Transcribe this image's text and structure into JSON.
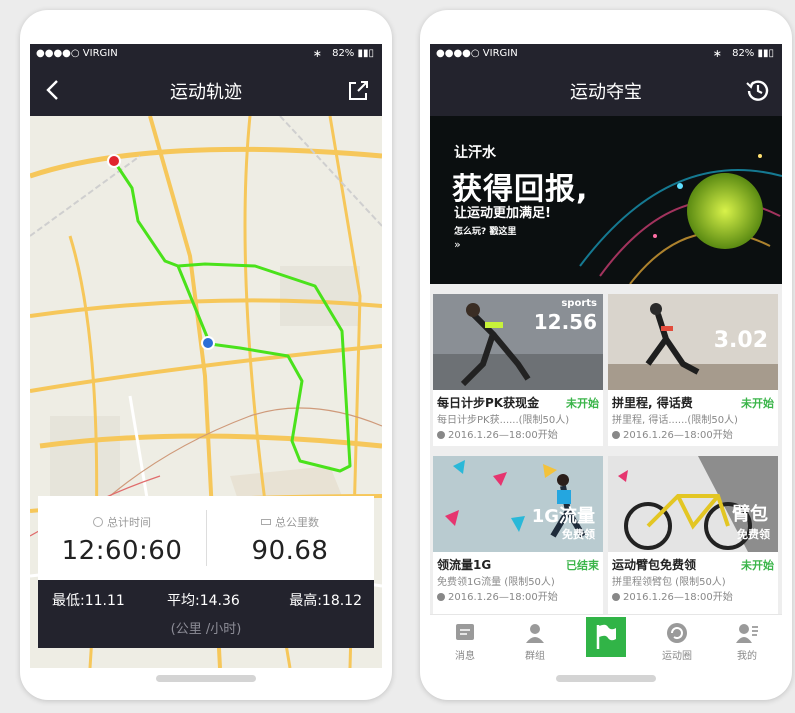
{
  "left_phone": {
    "status": {
      "carrier": "●●●●○ VIRGIN",
      "bluetooth": "∗",
      "battery": "82%"
    },
    "nav": {
      "title": "运动轨迹",
      "back_icon": "back-chevron-icon",
      "share_icon": "share-icon"
    },
    "stats": {
      "total_time_label": "总计时间",
      "total_time_value": "12:60:60",
      "total_distance_label": "总公里数",
      "total_distance_value": "90.68",
      "min_label": "最低:11.11",
      "avg_label": "平均:14.36",
      "max_label": "最高:18.12",
      "unit": "(公里 /小时)"
    },
    "map": {
      "route_color": "#4ae21b",
      "start_color": "#e0262e",
      "current_color": "#2d6fd6"
    }
  },
  "right_phone": {
    "status": {
      "carrier": "●●●●○ VIRGIN",
      "bluetooth": "∗",
      "battery": "82%"
    },
    "nav": {
      "title": "运动夺宝",
      "history_icon": "history-icon"
    },
    "banner": {
      "line1": "让汗水",
      "line2": "获得回报,",
      "line3": "让运动更加满足!",
      "line4": "怎么玩? 戳这里",
      "line5": "»"
    },
    "cards": [
      {
        "title": "每日计步PK获现金",
        "status": "未开始",
        "desc": "每日计步PK获......(限制50人)",
        "time": "2016.1.26—18:00开始",
        "overlay": "sports\n12.56 KM"
      },
      {
        "title": "拼里程, 得话费",
        "status": "未开始",
        "desc": "拼里程, 得话......(限制50人)",
        "time": "2016.1.26—18:00开始",
        "overlay": "3.02"
      },
      {
        "title": "领流量1G",
        "status": "已结束",
        "desc": "免费领1G流量    (限制50人)",
        "time": "2016.1.26—18:00开始",
        "overlay": "1G流量 免费领"
      },
      {
        "title": "运动臂包免费领",
        "status": "未开始",
        "desc": "拼里程领臂包    (限制50人)",
        "time": "2016.1.26—18:00开始",
        "overlay": "臂包 免费领"
      }
    ],
    "tabs": [
      {
        "label": "消息",
        "icon": "message-icon"
      },
      {
        "label": "群组",
        "icon": "group-icon"
      },
      {
        "label": "",
        "icon": "flag-icon"
      },
      {
        "label": "运动圈",
        "icon": "sport-circle-icon"
      },
      {
        "label": "我的",
        "icon": "profile-icon"
      }
    ],
    "accent": "#31b447"
  }
}
